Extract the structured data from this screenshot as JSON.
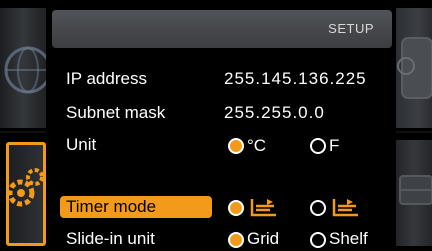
{
  "header": {
    "title": "SETUP"
  },
  "settings": {
    "ip_address": {
      "label": "IP address",
      "value": "255.145.136.225"
    },
    "subnet_mask": {
      "label": "Subnet mask",
      "value": "255.255.0.0"
    },
    "unit": {
      "label": "Unit",
      "options": [
        "°C",
        "F"
      ],
      "selected": "°C"
    },
    "timer_mode": {
      "label": "Timer mode",
      "options": [
        "mode-1",
        "mode-2"
      ],
      "selected": "mode-1"
    },
    "slide_in_unit": {
      "label": "Slide-in unit",
      "options": [
        "Grid",
        "Shelf"
      ],
      "selected": "Grid"
    }
  },
  "colors": {
    "accent": "#f39a1a",
    "background": "#000000",
    "header": "#46484b"
  },
  "icons": {
    "left_top": "globe-icon",
    "left_bottom": "gears-icon",
    "right_top": "device-icon",
    "right_bottom": "tray-icon",
    "timer_mode_1": "timer-start-icon",
    "timer_mode_2": "timer-stop-icon"
  }
}
